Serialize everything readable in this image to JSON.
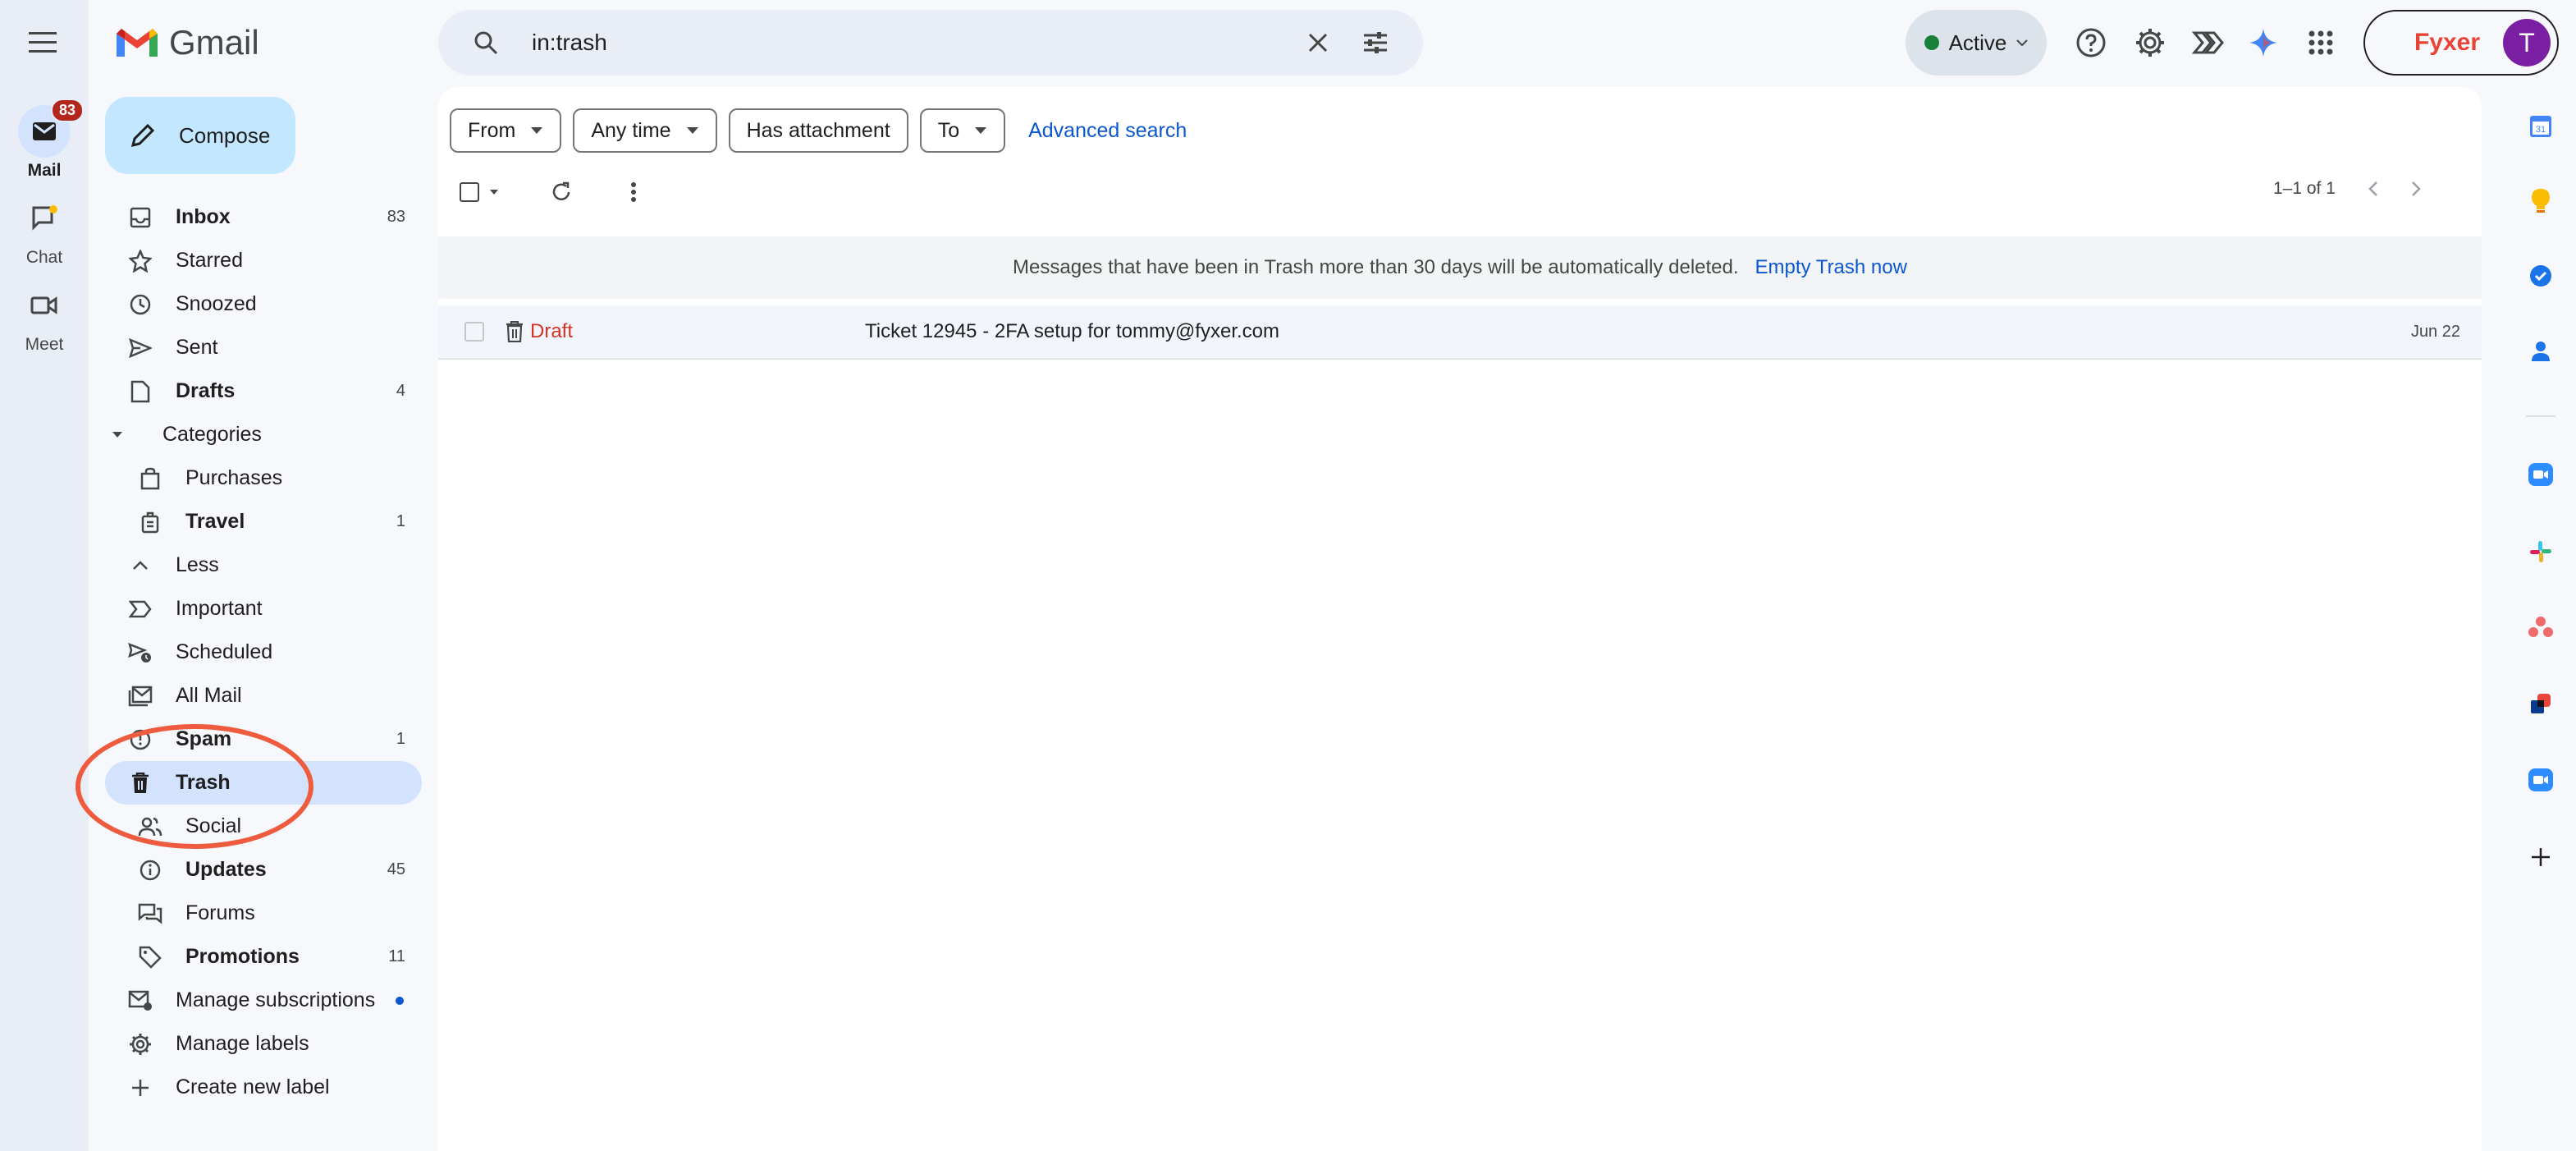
{
  "rail": {
    "items": [
      {
        "label": "Mail",
        "badge": "83"
      },
      {
        "label": "Chat"
      },
      {
        "label": "Meet"
      }
    ]
  },
  "header": {
    "logo_text": "Gmail",
    "search_value": "in:trash",
    "status": "Active",
    "fyxer_label": "Fyxer",
    "avatar_letter": "T"
  },
  "compose_label": "Compose",
  "nav": {
    "inbox": {
      "label": "Inbox",
      "count": "83"
    },
    "starred": {
      "label": "Starred"
    },
    "snoozed": {
      "label": "Snoozed"
    },
    "sent": {
      "label": "Sent"
    },
    "drafts": {
      "label": "Drafts",
      "count": "4"
    },
    "categories": {
      "label": "Categories"
    },
    "purchases": {
      "label": "Purchases"
    },
    "travel": {
      "label": "Travel",
      "count": "1"
    },
    "less": {
      "label": "Less"
    },
    "important": {
      "label": "Important"
    },
    "scheduled": {
      "label": "Scheduled"
    },
    "allmail": {
      "label": "All Mail"
    },
    "spam": {
      "label": "Spam",
      "count": "1"
    },
    "trash": {
      "label": "Trash"
    },
    "social": {
      "label": "Social"
    },
    "updates": {
      "label": "Updates",
      "count": "45"
    },
    "forums": {
      "label": "Forums"
    },
    "promotions": {
      "label": "Promotions",
      "count": "11"
    },
    "manage_subs": {
      "label": "Manage subscriptions"
    },
    "manage_labels": {
      "label": "Manage labels"
    },
    "create_label": {
      "label": "Create new label"
    }
  },
  "filters": {
    "from": "From",
    "any_time": "Any time",
    "has_attachment": "Has attachment",
    "to": "To",
    "advanced": "Advanced search"
  },
  "pager": {
    "range": "1–1 of 1"
  },
  "banner": {
    "text": "Messages that have been in Trash more than 30 days will be automatically deleted.",
    "action": "Empty Trash now"
  },
  "messages": [
    {
      "sender": "Draft",
      "subject": "Ticket 12945 - 2FA setup for tommy@fyxer.com",
      "date": "Jun 22"
    }
  ],
  "colors": {
    "accent": "#0b57d0",
    "compose_bg": "#c2e7ff",
    "active_nav": "#d3e3fd",
    "draft_red": "#d93025",
    "annotation": "#ef5b3e"
  }
}
